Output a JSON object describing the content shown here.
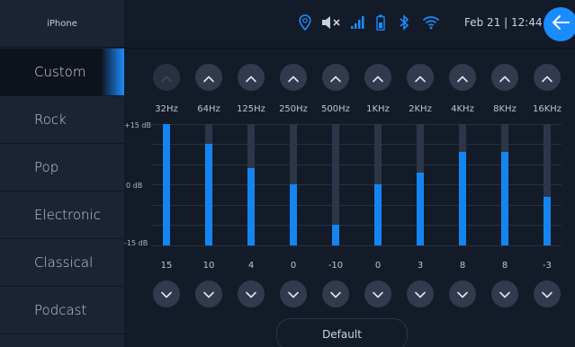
{
  "sidebar": {
    "title": "iPhone",
    "items": [
      {
        "label": "Custom",
        "active": true
      },
      {
        "label": "Rock"
      },
      {
        "label": "Pop"
      },
      {
        "label": "Electronic"
      },
      {
        "label": "Classical"
      },
      {
        "label": "Podcast"
      }
    ]
  },
  "status": {
    "datetime": "Feb 21 | 12:44",
    "icons": [
      "location-pin-icon",
      "volume-muted-icon",
      "cellular-signal-icon",
      "battery-icon",
      "bluetooth-icon",
      "wifi-icon",
      "back-arrow-icon"
    ],
    "accent": "#1a8cff"
  },
  "equalizer": {
    "scale": {
      "top": "+15 dB",
      "mid": "0 dB",
      "bottom": "-15 dB"
    },
    "range": [
      -15,
      15
    ],
    "bands": [
      {
        "freq": "32Hz",
        "gain": 15,
        "label": "15"
      },
      {
        "freq": "64Hz",
        "gain": 10,
        "label": "10"
      },
      {
        "freq": "125Hz",
        "gain": 4,
        "label": "4"
      },
      {
        "freq": "250Hz",
        "gain": 0,
        "label": "0"
      },
      {
        "freq": "500Hz",
        "gain": -10,
        "label": "-10"
      },
      {
        "freq": "1KHz",
        "gain": 0,
        "label": "0"
      },
      {
        "freq": "2KHz",
        "gain": 3,
        "label": "3"
      },
      {
        "freq": "4KHz",
        "gain": 8,
        "label": "8"
      },
      {
        "freq": "8KHz",
        "gain": 8,
        "label": "8"
      },
      {
        "freq": "16KHz",
        "gain": -3,
        "label": "-3"
      }
    ],
    "fill_color": "#1385f0",
    "default_label": "Default"
  }
}
